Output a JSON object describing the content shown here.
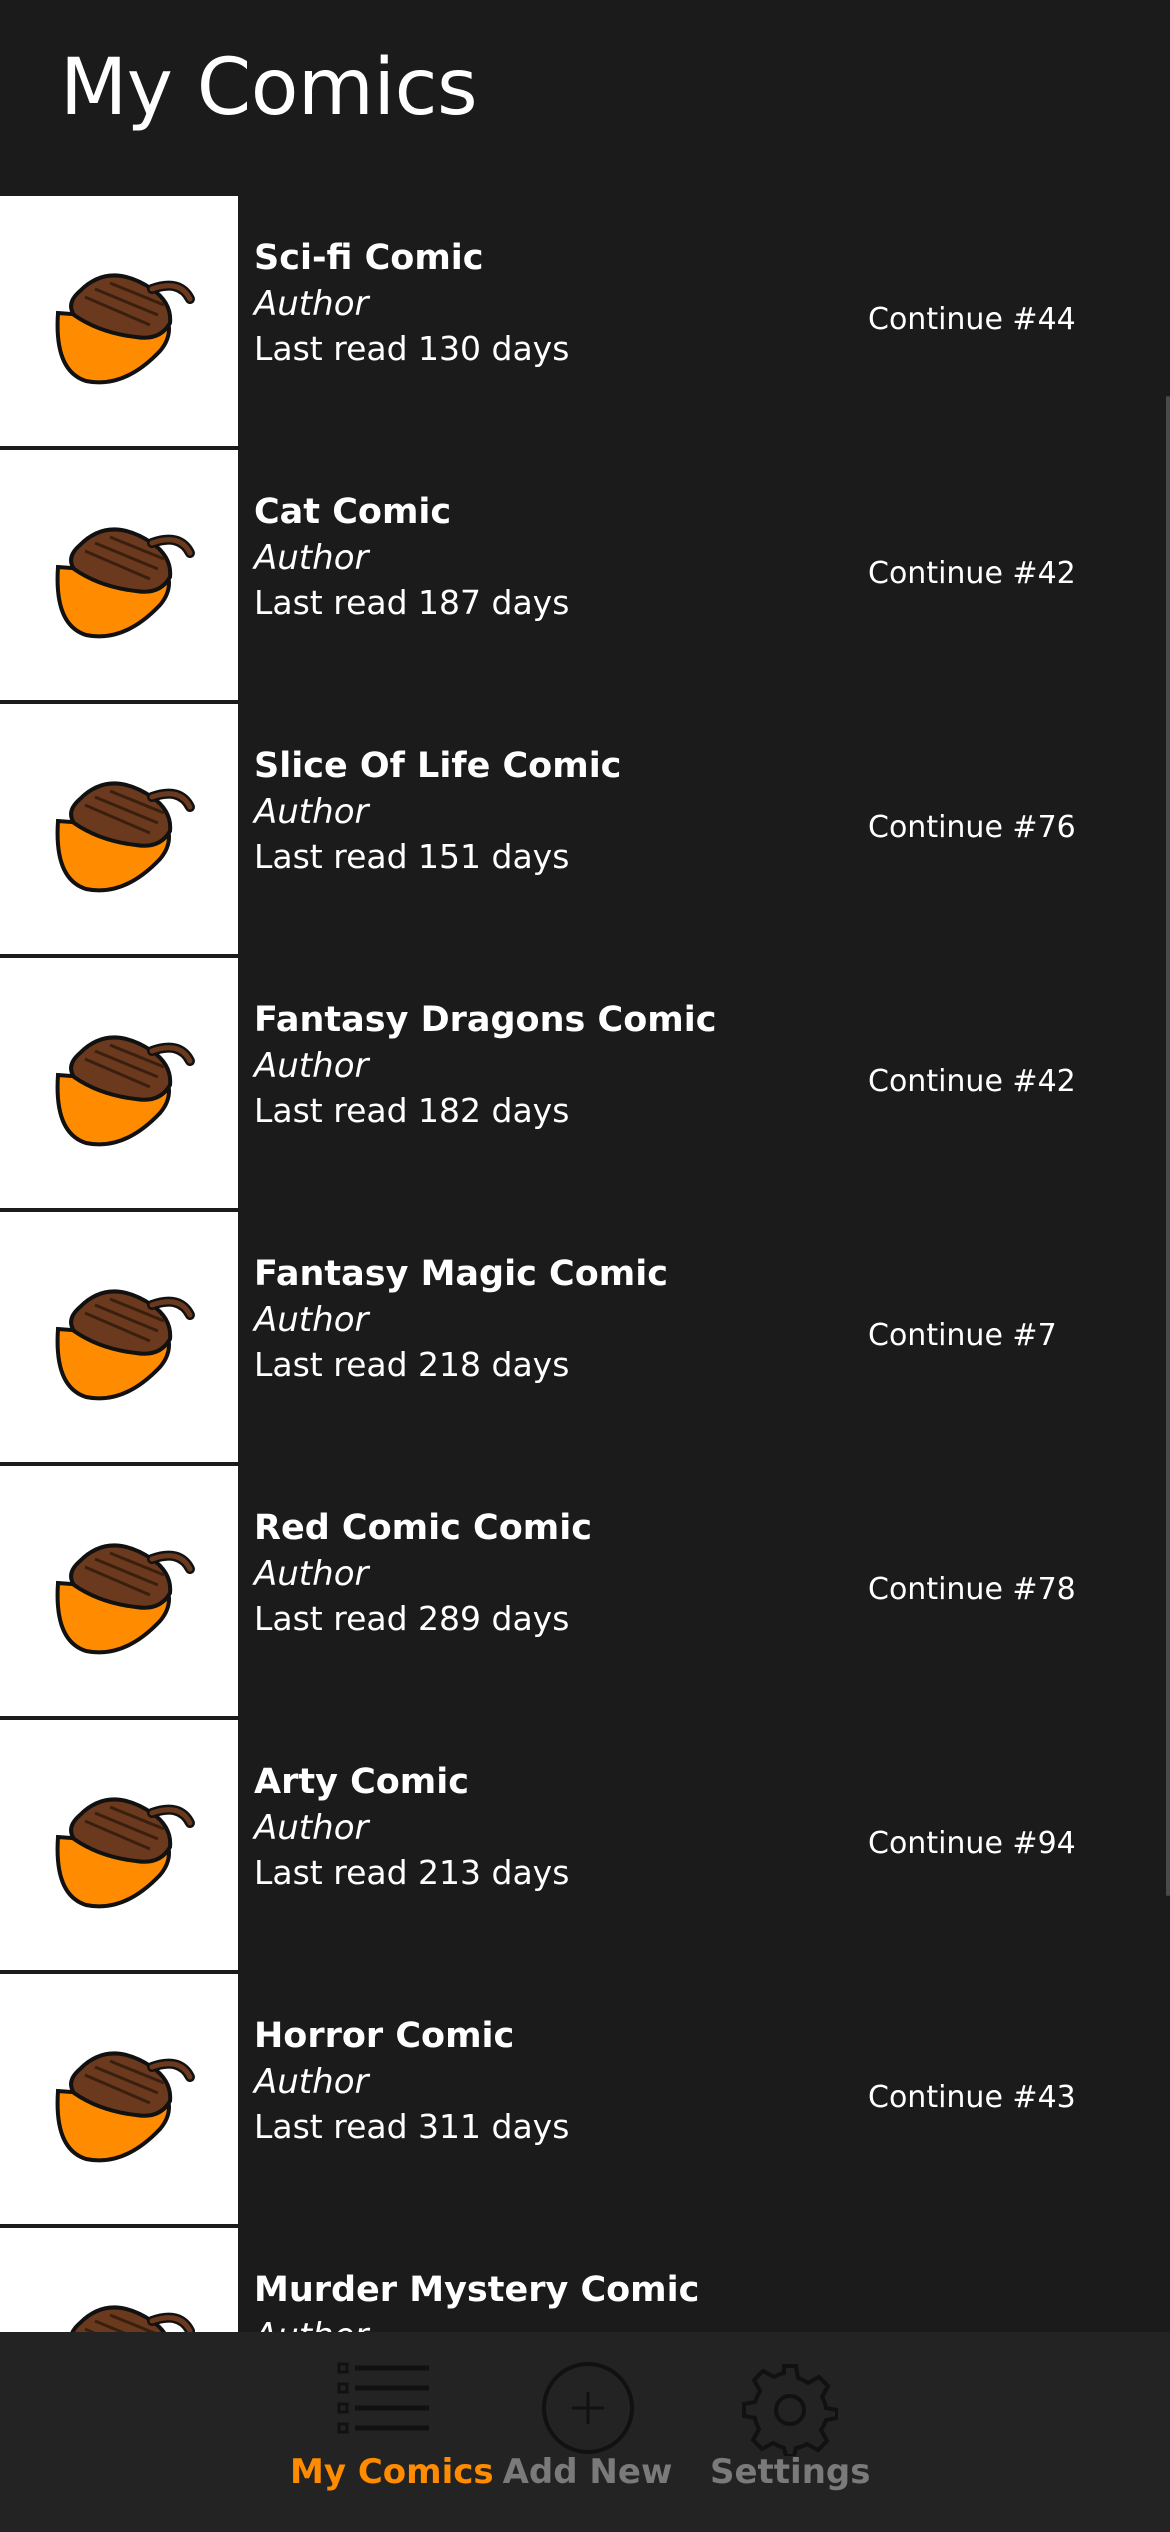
{
  "header": {
    "title": "My Comics"
  },
  "comics": [
    {
      "title": "Sci-fi Comic",
      "author": "Author",
      "last_read": "Last read 130 days",
      "continue": "Continue #44"
    },
    {
      "title": "Cat Comic",
      "author": "Author",
      "last_read": "Last read 187 days",
      "continue": "Continue #42"
    },
    {
      "title": "Slice Of Life Comic",
      "author": "Author",
      "last_read": "Last read 151 days",
      "continue": "Continue #76"
    },
    {
      "title": "Fantasy Dragons Comic",
      "author": "Author",
      "last_read": "Last read 182 days",
      "continue": "Continue #42"
    },
    {
      "title": "Fantasy Magic Comic",
      "author": "Author",
      "last_read": "Last read 218 days",
      "continue": "Continue #7"
    },
    {
      "title": "Red Comic Comic",
      "author": "Author",
      "last_read": "Last read 289 days",
      "continue": "Continue #78"
    },
    {
      "title": "Arty Comic",
      "author": "Author",
      "last_read": "Last read 213 days",
      "continue": "Continue #94"
    },
    {
      "title": "Horror Comic",
      "author": "Author",
      "last_read": "Last read 311 days",
      "continue": "Continue #43"
    },
    {
      "title": "Murder Mystery Comic",
      "author": "Author",
      "last_read": "",
      "continue": ""
    }
  ],
  "tabbar": {
    "tabs": [
      {
        "label": "My Comics",
        "icon": "list-icon",
        "active": true
      },
      {
        "label": "Add New",
        "icon": "add-circle-icon",
        "active": false
      },
      {
        "label": "Settings",
        "icon": "gear-icon",
        "active": false
      }
    ]
  },
  "colors": {
    "background": "#1b1b1b",
    "accent": "#ff8c00",
    "inactive": "#7a7a7a",
    "thumb_bg": "#ffffff"
  }
}
